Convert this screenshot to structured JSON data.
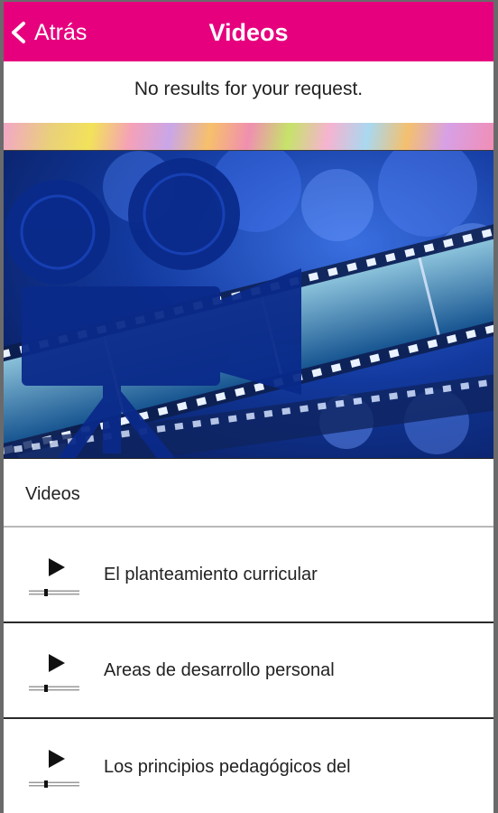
{
  "header": {
    "back_label": "Atrás",
    "title": "Videos",
    "background_color": "#e6007e"
  },
  "status": {
    "message": "No results for your request."
  },
  "banner": {
    "image": "film-camera-and-filmstrip-illustration"
  },
  "section": {
    "title": "Videos"
  },
  "videos": [
    {
      "label": "El planteamiento curricular",
      "icon": "play-icon"
    },
    {
      "label": "Areas de desarrollo personal",
      "icon": "play-icon"
    },
    {
      "label": "Los principios pedagógicos del",
      "icon": "play-icon"
    }
  ]
}
